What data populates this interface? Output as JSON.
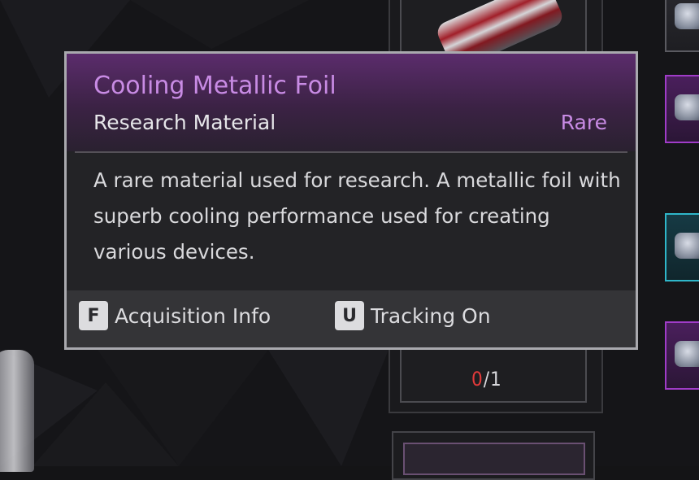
{
  "tooltip": {
    "title": "Cooling Metallic Foil",
    "type": "Research Material",
    "rarity": "Rare",
    "description": "A rare material used for research. A metallic foil with superb cooling performance used for creating various devices.",
    "actions": [
      {
        "key": "F",
        "label": "Acquisition Info"
      },
      {
        "key": "U",
        "label": "Tracking On"
      }
    ]
  },
  "inventory": {
    "count_have": "0",
    "count_separator": "/",
    "count_need": "1"
  },
  "colors": {
    "rarity_purple": "#c88be4",
    "count_missing_red": "#e23a3a",
    "slot_purple": "#a03cc8",
    "slot_cyan": "#2fb6c9"
  }
}
